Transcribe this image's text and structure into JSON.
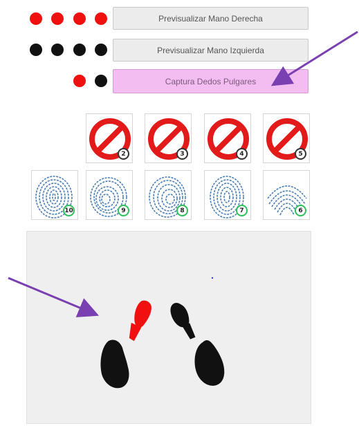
{
  "buttons": {
    "right_preview": "Previsualizar Mano Derecha",
    "left_preview": "Previsualizar Mano Izquierda",
    "thumbs_capture": "Captura Dedos Pulgares"
  },
  "colors": {
    "red": "#f01010",
    "black": "#111111",
    "active_button": "#f4bdf2",
    "arrow": "#7a3fb0",
    "ok_badge": "#2fbf5a"
  },
  "status_dots": {
    "right_hand": [
      "red",
      "red",
      "red",
      "red"
    ],
    "left_hand": [
      "black",
      "black",
      "black",
      "black"
    ],
    "thumbs": [
      "red",
      "black"
    ]
  },
  "disabled_fingers": [
    {
      "number": "2",
      "icon": "no-entry-icon"
    },
    {
      "number": "3",
      "icon": "no-entry-icon"
    },
    {
      "number": "4",
      "icon": "no-entry-icon"
    },
    {
      "number": "5",
      "icon": "no-entry-icon"
    }
  ],
  "captured_fingers": [
    {
      "number": "10",
      "icon": "fingerprint-icon"
    },
    {
      "number": "9",
      "icon": "fingerprint-icon"
    },
    {
      "number": "8",
      "icon": "fingerprint-icon"
    },
    {
      "number": "7",
      "icon": "fingerprint-icon"
    },
    {
      "number": "6",
      "icon": "fingerprint-icon"
    }
  ],
  "preview": {
    "left_thumb_color": "red",
    "right_thumb_color": "black"
  }
}
